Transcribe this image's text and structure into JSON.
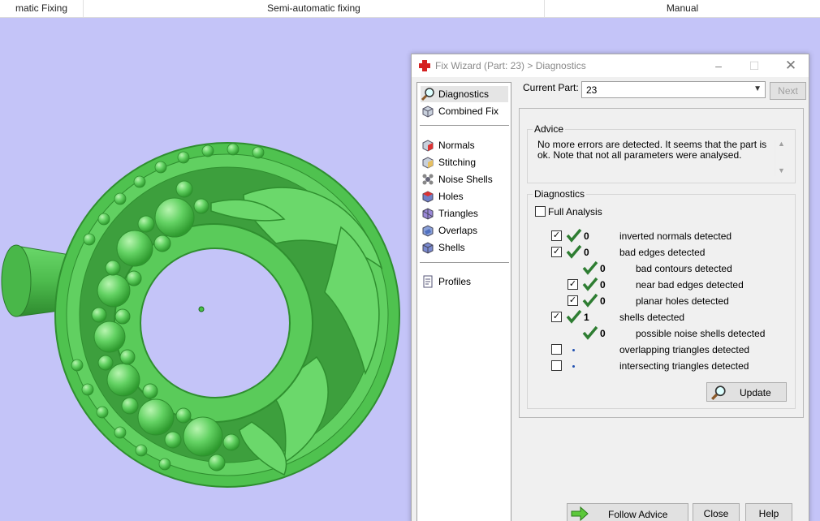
{
  "ribbon": {
    "groups": [
      "matic Fixing",
      "Semi-automatic fixing",
      "Manual"
    ]
  },
  "dialog": {
    "title": "Fix Wizard (Part: 23) > Diagnostics",
    "nav": [
      {
        "label": "Diagnostics",
        "icon": "magnifier-icon",
        "selected": true
      },
      {
        "label": "Combined Fix",
        "icon": "cube-fix-icon"
      },
      {
        "label": "Normals",
        "icon": "normals-cube-icon"
      },
      {
        "label": "Stitching",
        "icon": "stitching-cube-icon"
      },
      {
        "label": "Noise Shells",
        "icon": "noise-shells-icon"
      },
      {
        "label": "Holes",
        "icon": "holes-cube-icon"
      },
      {
        "label": "Triangles",
        "icon": "triangles-cube-icon"
      },
      {
        "label": "Overlaps",
        "icon": "overlaps-cube-icon"
      },
      {
        "label": "Shells",
        "icon": "shells-cube-icon"
      },
      {
        "label": "Profiles",
        "icon": "profile-document-icon"
      }
    ],
    "current_part_label": "Current Part:",
    "current_part_value": "23",
    "next_label": "Next",
    "advice": {
      "title": "Advice",
      "text": "No more errors are detected. It seems that the part is ok. Note that not all parameters were analysed."
    },
    "diagnostics": {
      "title": "Diagnostics",
      "full_analysis_label": "Full Analysis",
      "rows": [
        {
          "checkbox": true,
          "status": "check",
          "count": "0",
          "label": "inverted normals detected"
        },
        {
          "checkbox": true,
          "status": "check",
          "count": "0",
          "label": "bad edges detected"
        },
        {
          "checkbox": null,
          "status": "check",
          "count": "0",
          "label": "bad contours detected"
        },
        {
          "checkbox": true,
          "status": "check",
          "count": "0",
          "label": "near bad edges detected"
        },
        {
          "checkbox": true,
          "status": "check",
          "count": "0",
          "label": "planar holes detected"
        },
        {
          "checkbox": true,
          "status": "check",
          "count": "1",
          "label": "shells detected"
        },
        {
          "checkbox": null,
          "status": "check",
          "count": "0",
          "label": "possible noise shells detected"
        },
        {
          "checkbox": false,
          "status": "dot",
          "count": "",
          "label": "overlapping triangles detected"
        },
        {
          "checkbox": false,
          "status": "dot",
          "count": "",
          "label": "intersecting triangles detected"
        }
      ],
      "update_label": "Update"
    },
    "buttons": {
      "follow_advice": "Follow Advice",
      "close": "Close",
      "help": "Help"
    }
  },
  "colors": {
    "viewport_bg": "#c4c4f8",
    "model_green": "#5ccf5c",
    "check_green": "#2e7d32"
  }
}
